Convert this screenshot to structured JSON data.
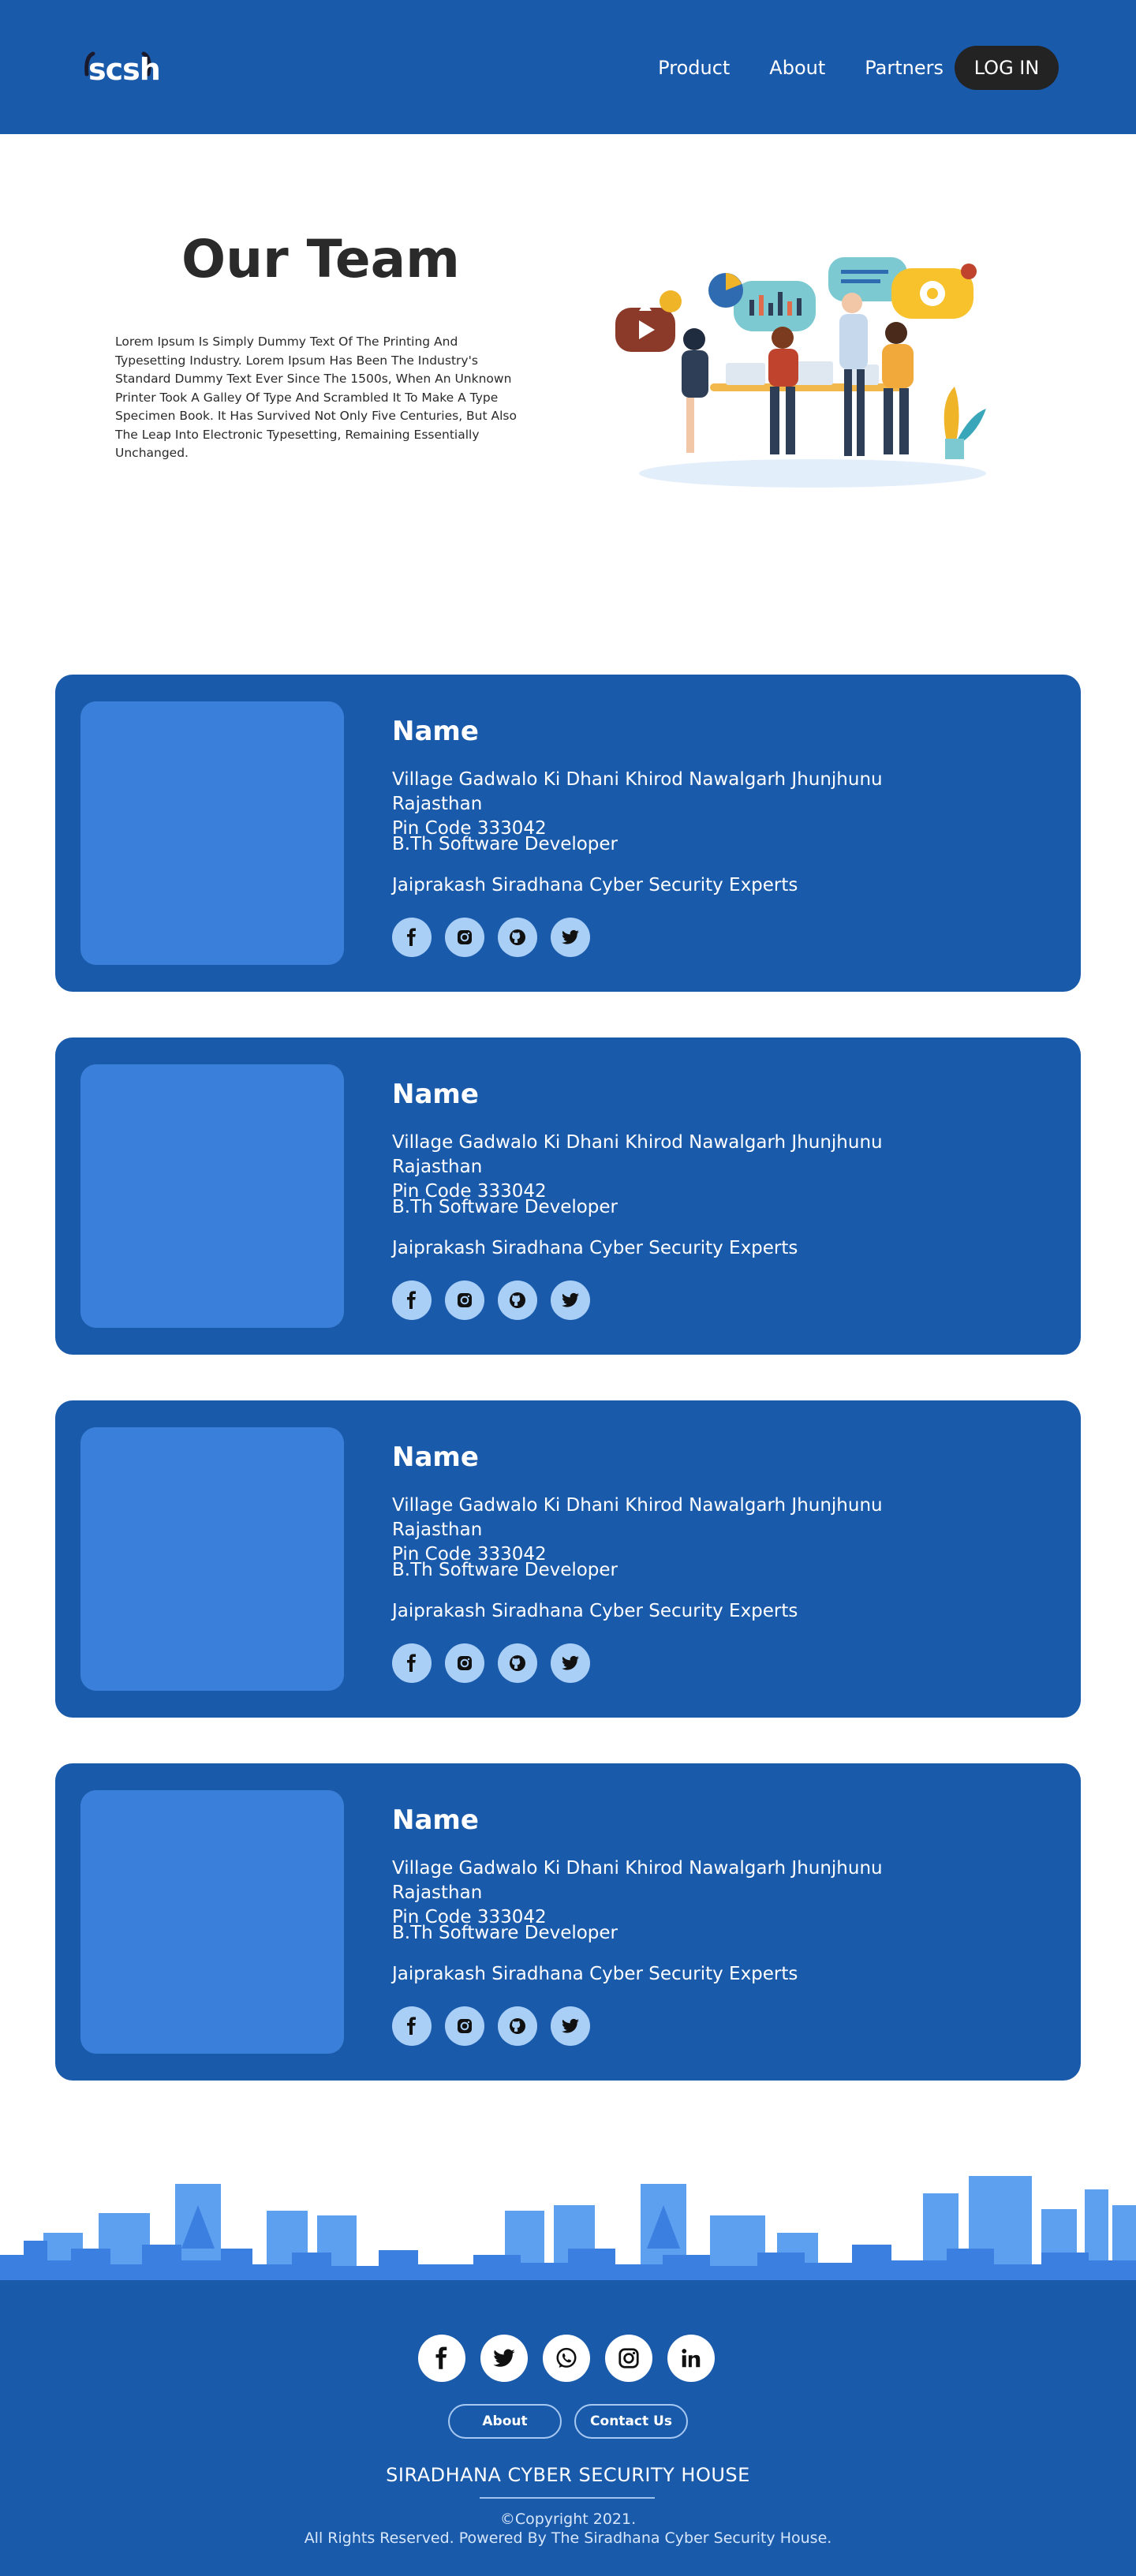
{
  "header": {
    "logo": "scsh",
    "nav": [
      "Product",
      "About",
      "Partners"
    ],
    "login": "LOG IN"
  },
  "hero": {
    "title": "Our Team",
    "text": "Lorem Ipsum Is Simply Dummy Text Of The Printing And Typesetting Industry. Lorem Ipsum Has Been The Industry's Standard Dummy Text Ever Since The 1500s, When An Unknown Printer Took A Galley Of Type And Scrambled It To Make A Type Specimen Book. It Has Survived Not Only Five Centuries, But Also The Leap Into Electronic Typesetting, Remaining Essentially Unchanged."
  },
  "members": [
    {
      "name": "Name",
      "address_line1": "Village Gadwalo Ki Dhani Khirod  Nawalgarh Jhunjhunu Rajasthan",
      "address_line2": "Pin Code 333042",
      "role": "B.Th Software Developer",
      "org": "Jaiprakash Siradhana Cyber Security Experts",
      "social": [
        "facebook-icon",
        "instagram-icon",
        "github-icon",
        "twitter-icon"
      ]
    },
    {
      "name": "Name",
      "address_line1": "Village Gadwalo Ki Dhani Khirod  Nawalgarh Jhunjhunu Rajasthan",
      "address_line2": "Pin Code 333042",
      "role": "B.Th Software Developer",
      "org": "Jaiprakash Siradhana Cyber Security Experts",
      "social": [
        "facebook-icon",
        "instagram-icon",
        "github-icon",
        "twitter-icon"
      ]
    },
    {
      "name": "Name",
      "address_line1": "Village Gadwalo Ki Dhani Khirod  Nawalgarh Jhunjhunu Rajasthan",
      "address_line2": "Pin Code 333042",
      "role": "B.Th Software Developer",
      "org": "Jaiprakash Siradhana Cyber Security Experts",
      "social": [
        "facebook-icon",
        "instagram-icon",
        "github-icon",
        "twitter-icon"
      ]
    },
    {
      "name": "Name",
      "address_line1": "Village Gadwalo Ki Dhani Khirod  Nawalgarh Jhunjhunu Rajasthan",
      "address_line2": "Pin Code 333042",
      "role": "B.Th Software Developer",
      "org": "Jaiprakash Siradhana Cyber Security Experts",
      "social": [
        "facebook-icon",
        "instagram-icon",
        "github-icon",
        "twitter-icon"
      ]
    }
  ],
  "footer": {
    "social": [
      "facebook-icon",
      "twitter-icon",
      "whatsapp-icon",
      "instagram-icon",
      "linkedin-icon"
    ],
    "buttons": [
      "About",
      "Contact Us"
    ],
    "title": "SIRADHANA CYBER SECURITY HOUSE",
    "copyright": "©Copyright 2021.",
    "rights": "All Rights Reserved. Powered By The Siradhana Cyber Security House."
  },
  "colors": {
    "primary": "#1a5aab",
    "photo_placeholder": "#3a80da",
    "social_bg": "#a9cff7",
    "login_bg": "#232323"
  }
}
